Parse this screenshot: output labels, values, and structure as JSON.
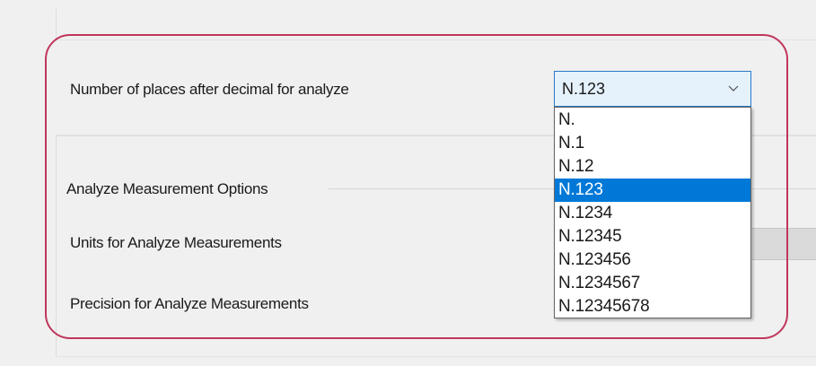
{
  "settings": {
    "decimal_places_label": "Number of places after decimal for analyze",
    "analyze_options_group": "Analyze Measurement Options",
    "units_label": "Units for Analyze Measurements",
    "precision_label": "Precision for Analyze Measurements"
  },
  "decimal_combo": {
    "selected": "N.123",
    "options": [
      "N.",
      "N.1",
      "N.12",
      "N.123",
      "N.1234",
      "N.12345",
      "N.123456",
      "N.1234567",
      "N.12345678"
    ],
    "selected_index": 3
  },
  "colors": {
    "highlight_frame": "#c0365a",
    "selection": "#0078d7",
    "combo_border": "#2a78c8",
    "combo_background": "#e5f1fb"
  }
}
